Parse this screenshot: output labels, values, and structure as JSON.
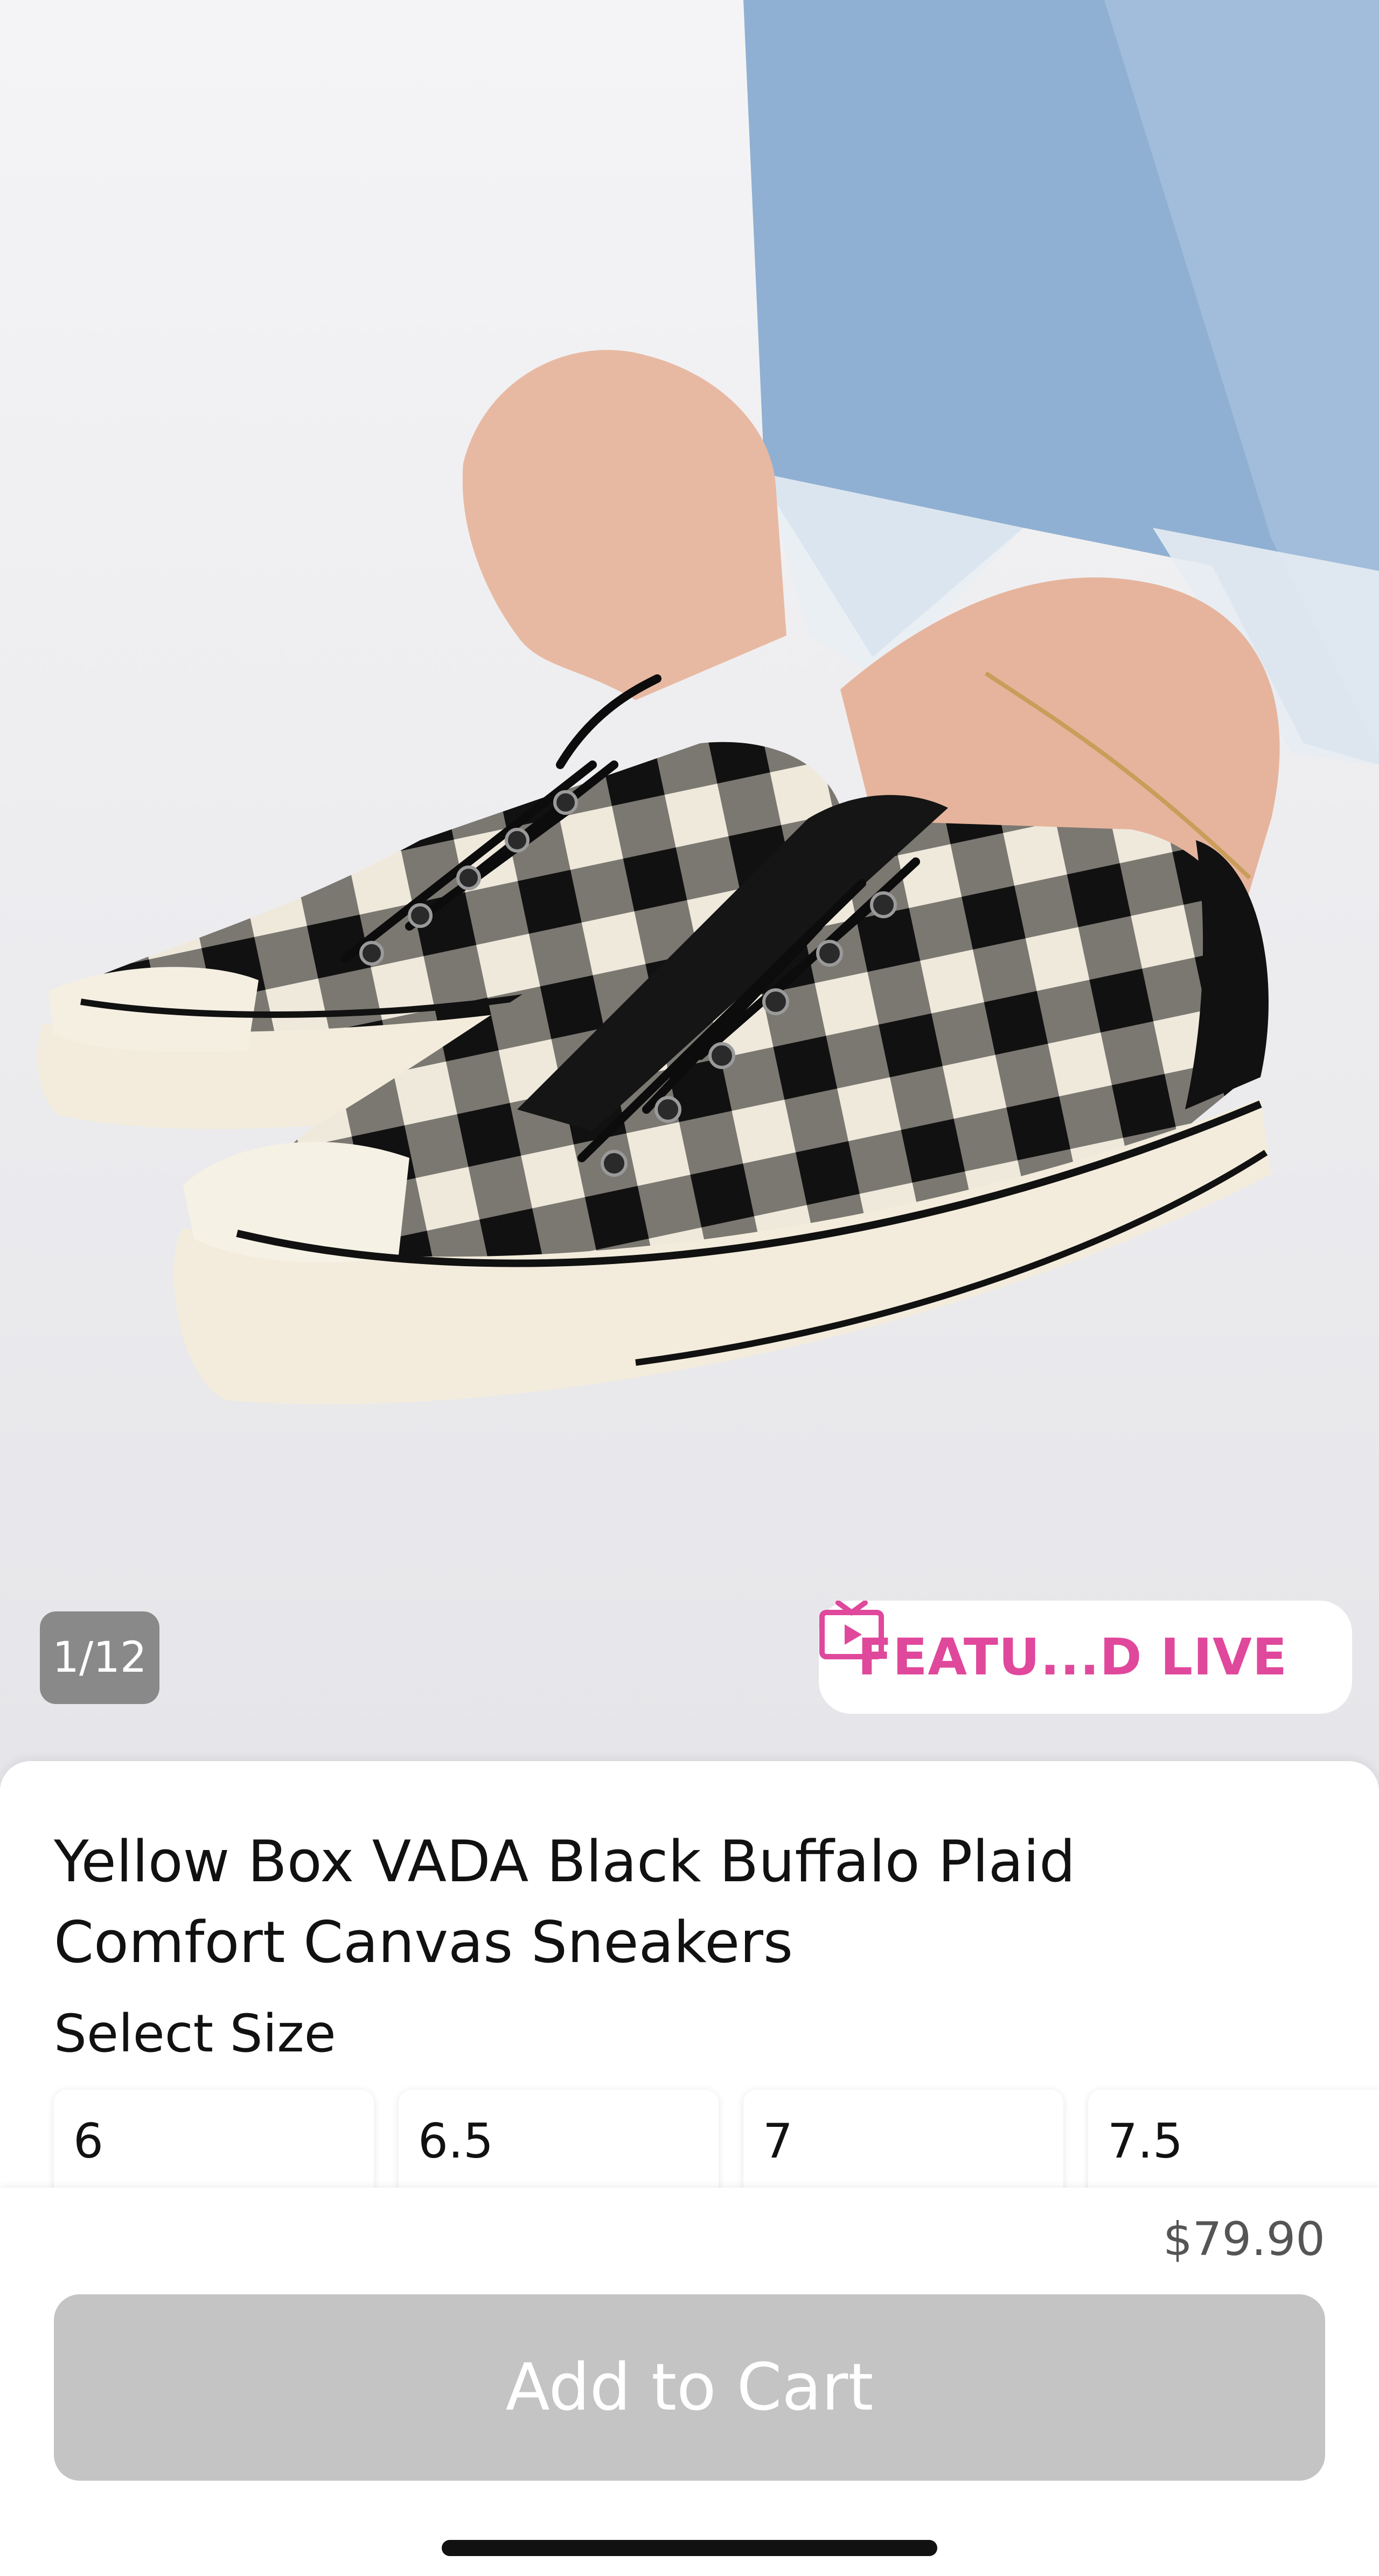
{
  "gallery": {
    "counter": "1/12",
    "live_badge": {
      "icon": "tv-play-icon",
      "label": "FEATU...D LIVE",
      "color": "#e0489c"
    }
  },
  "product": {
    "title_line1": "Yellow Box VADA Black Buffalo Plaid",
    "title_line2": "Comfort Canvas Sneakers",
    "select_size_label": "Select Size",
    "sizes": [
      "6",
      "6.5",
      "7",
      "7.5"
    ],
    "price": "$79.90"
  },
  "cart": {
    "add_to_cart_label": "Add to Cart",
    "button_color": "#c4c4c4"
  }
}
